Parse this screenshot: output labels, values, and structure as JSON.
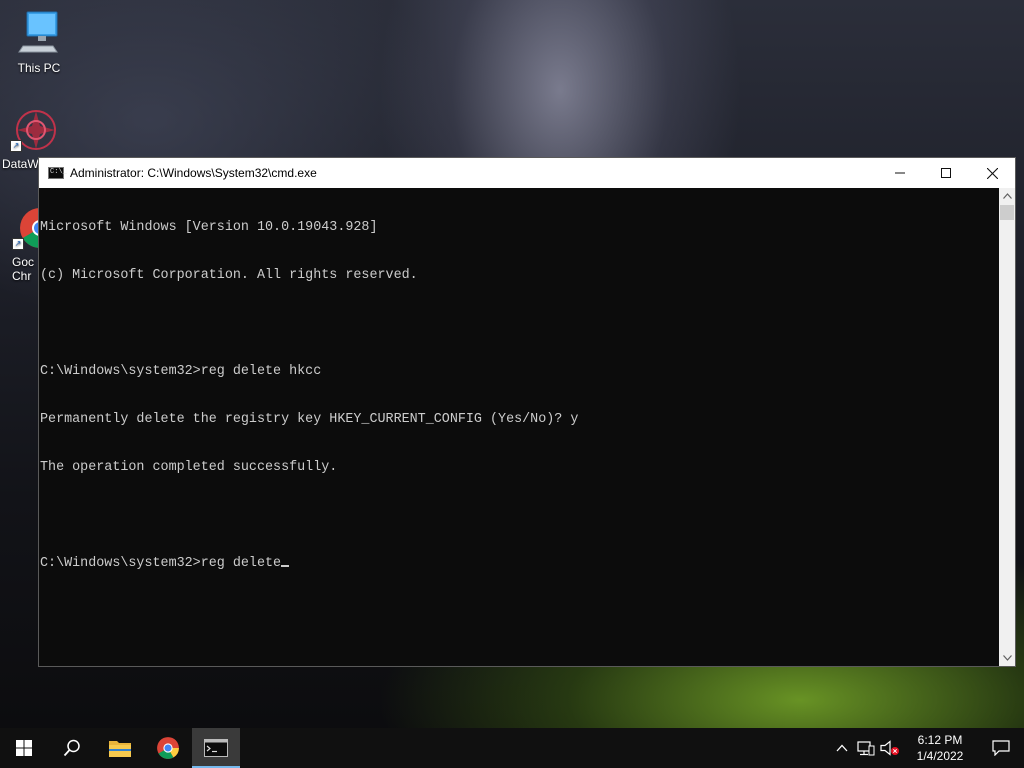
{
  "desktop": {
    "icons": [
      {
        "label": "This PC",
        "icon": "this-pc-icon"
      },
      {
        "label": "DataW",
        "icon": "datawrapper-icon"
      },
      {
        "label": "Goc\nChr",
        "icon": "chrome-icon"
      }
    ]
  },
  "window": {
    "title": "Administrator: C:\\Windows\\System32\\cmd.exe",
    "icon_text": "C:\\_",
    "buttons": [
      "minimize",
      "maximize",
      "close"
    ],
    "console_lines": [
      "Microsoft Windows [Version 10.0.19043.928]",
      "(c) Microsoft Corporation. All rights reserved.",
      "",
      "C:\\Windows\\system32>reg delete hkcc",
      "Permanently delete the registry key HKEY_CURRENT_CONFIG (Yes/No)? y",
      "The operation completed successfully.",
      "",
      "C:\\Windows\\system32>reg delete"
    ]
  },
  "taskbar": {
    "apps": [
      "start-icon",
      "search-icon",
      "file-explorer-icon",
      "chrome-icon",
      "cmd-icon"
    ],
    "tray": [
      "chevron-up-icon",
      "network-icon",
      "volume-muted-icon"
    ],
    "time": "6:12 PM",
    "date": "1/4/2022"
  }
}
